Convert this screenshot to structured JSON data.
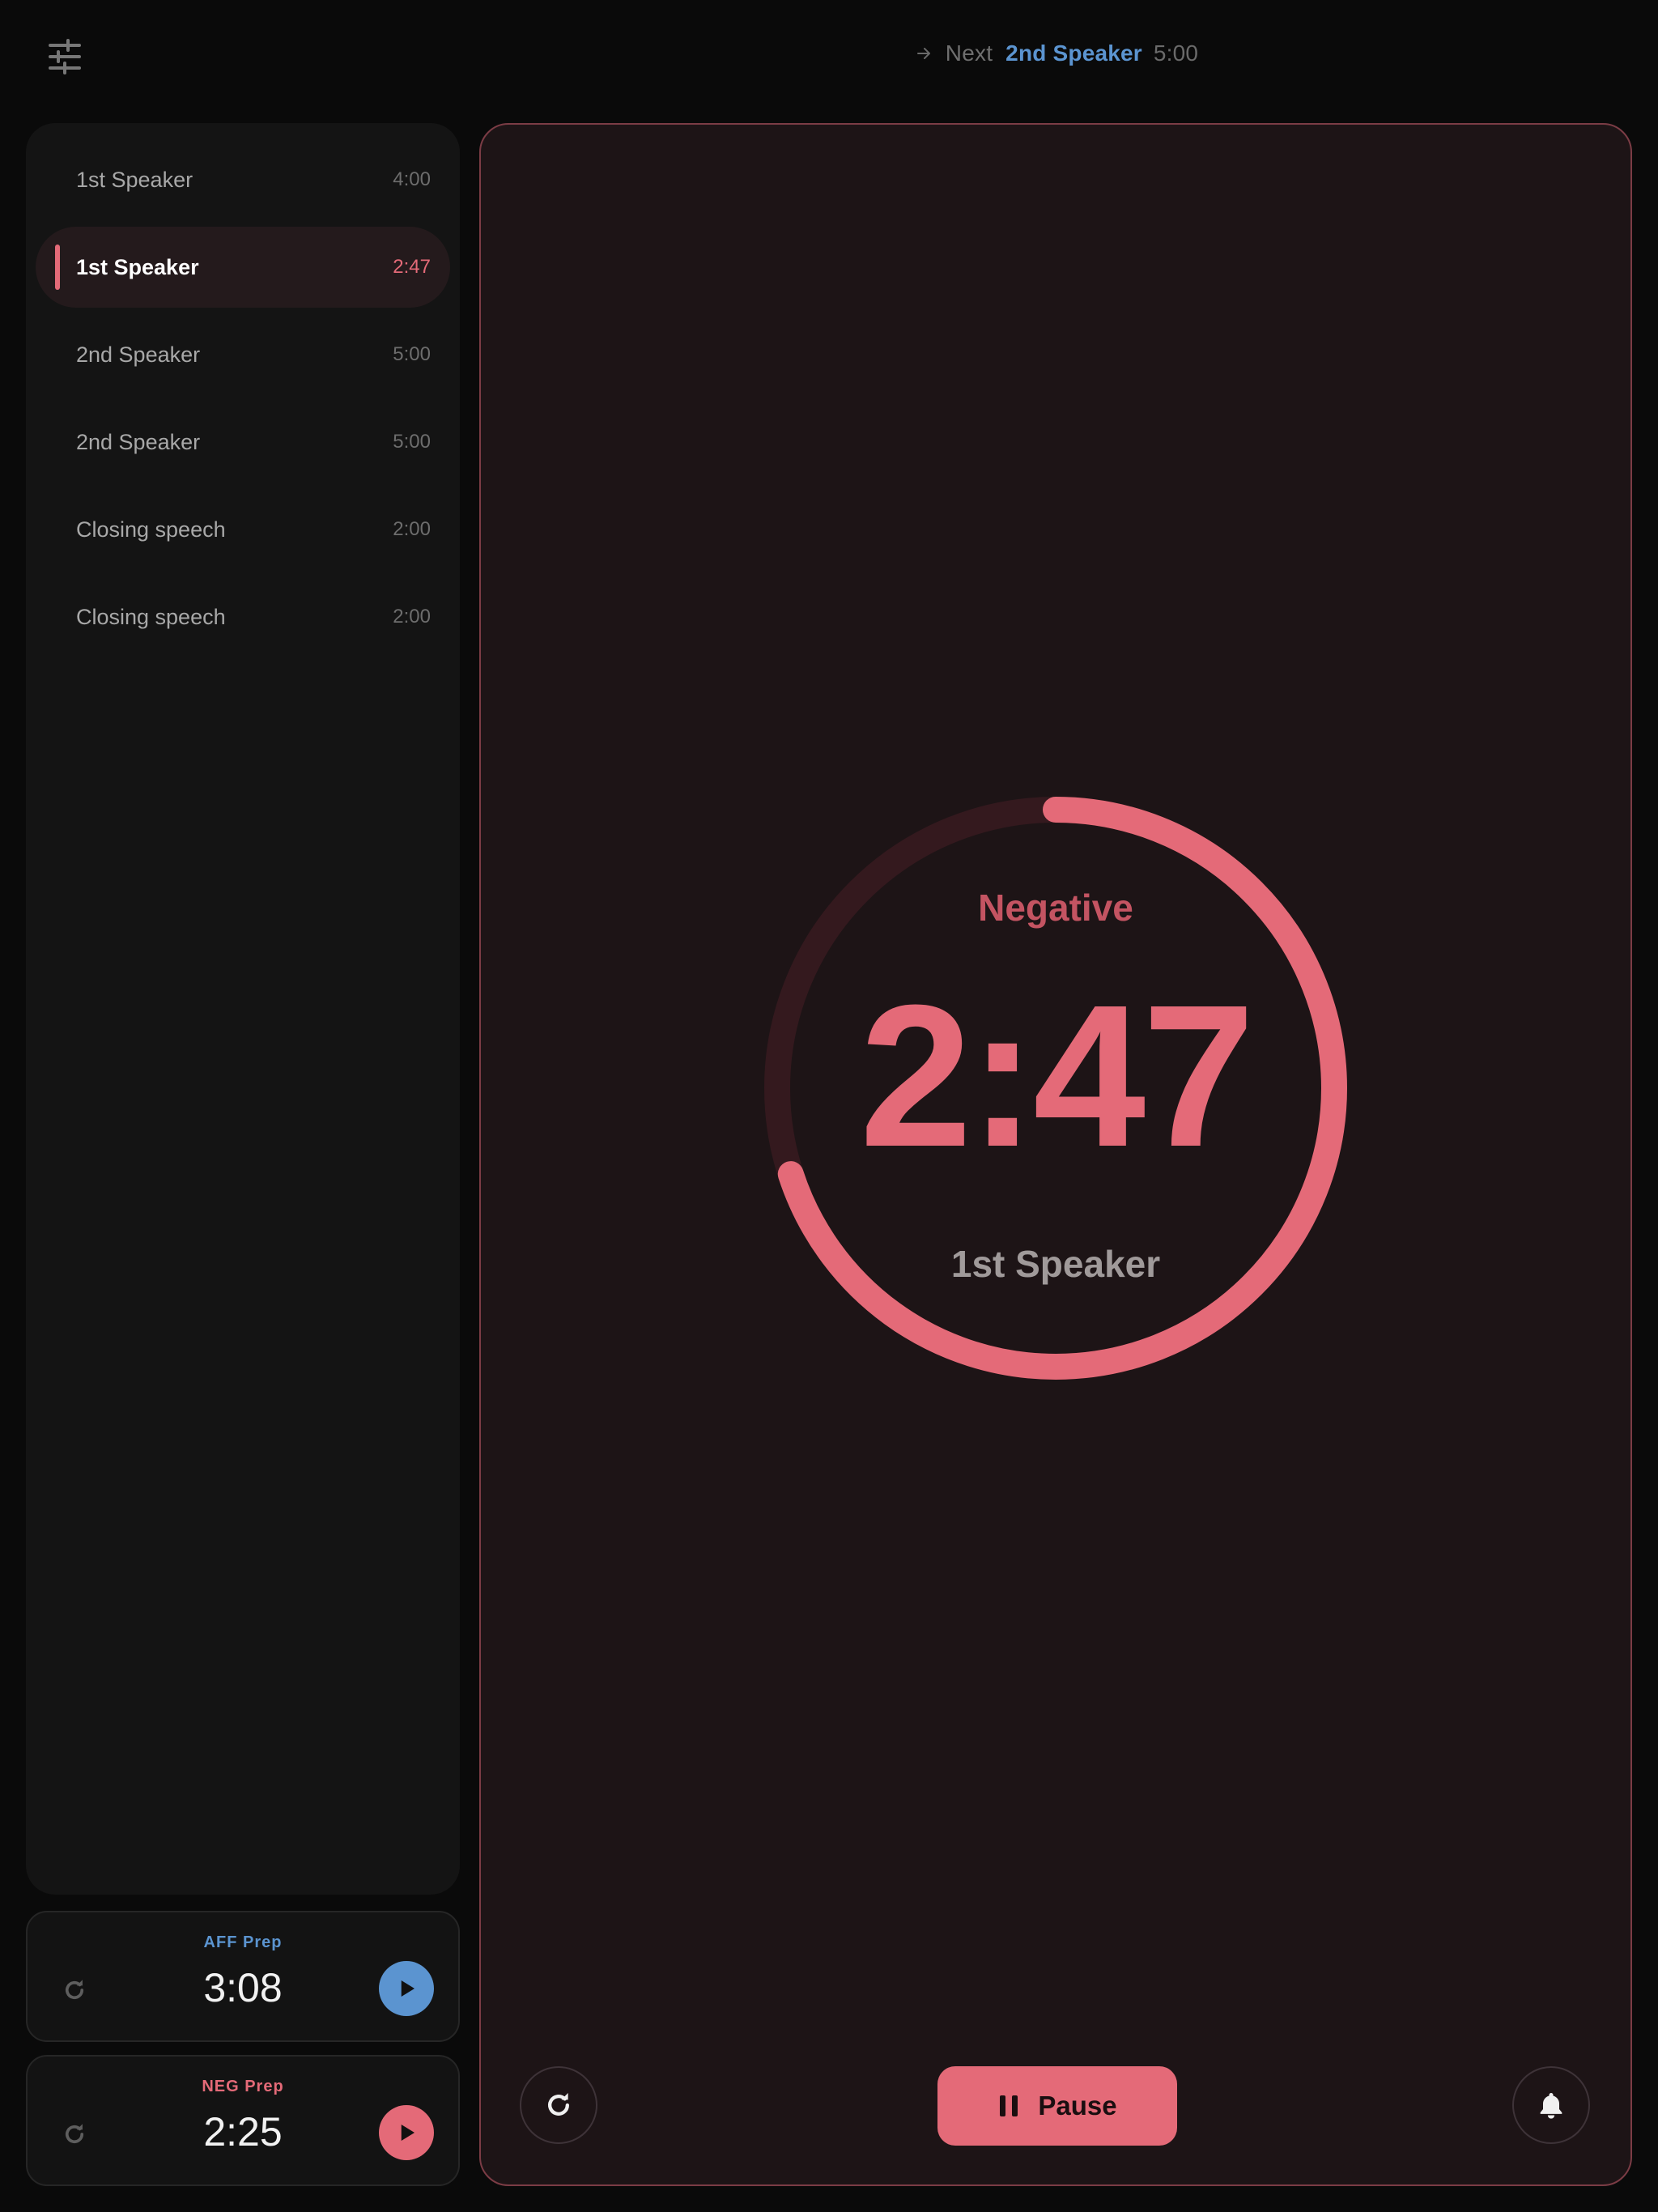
{
  "header": {
    "next_label": "Next",
    "next_speaker": "2nd Speaker",
    "next_time": "5:00"
  },
  "sidebar": {
    "items": [
      {
        "label": "1st Speaker",
        "duration": "4:00",
        "active": false
      },
      {
        "label": "1st Speaker",
        "duration": "2:47",
        "active": true
      },
      {
        "label": "2nd Speaker",
        "duration": "5:00",
        "active": false
      },
      {
        "label": "2nd Speaker",
        "duration": "5:00",
        "active": false
      },
      {
        "label": "Closing speech",
        "duration": "2:00",
        "active": false
      },
      {
        "label": "Closing speech",
        "duration": "2:00",
        "active": false
      }
    ]
  },
  "prep": {
    "aff": {
      "label": "AFF Prep",
      "time": "3:08",
      "color": "#5b94d0"
    },
    "neg": {
      "label": "NEG Prep",
      "time": "2:25",
      "color": "#e46a78"
    }
  },
  "timer": {
    "side": "Negative",
    "time": "2:47",
    "speaker": "1st Speaker",
    "progress_remaining": 0.7
  },
  "controls": {
    "pause_label": "Pause"
  },
  "colors": {
    "accent_neg": "#e46a78",
    "accent_aff": "#5b94d0",
    "card_bg": "#1d1416"
  },
  "icons": [
    "settings-sliders-icon",
    "arrow-right-icon",
    "reset-icon",
    "play-icon",
    "pause-icon",
    "bell-icon"
  ]
}
